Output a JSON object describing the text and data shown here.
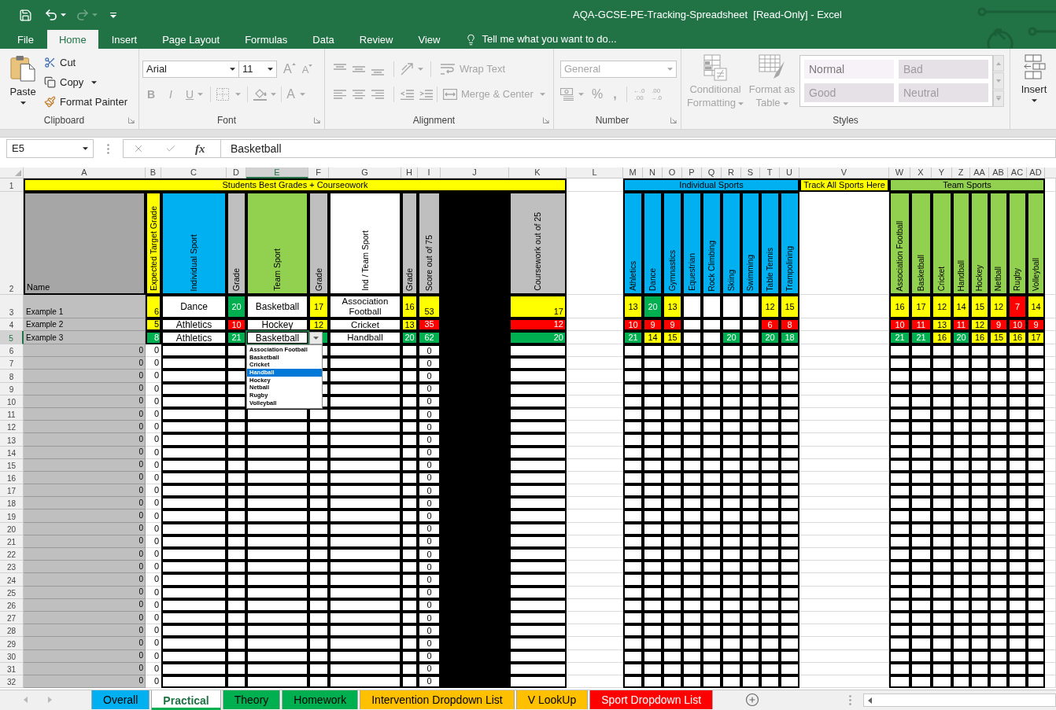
{
  "title_bar": {
    "title": "AQA-GCSE-PE-Tracking-Spreadsheet  [Read-Only] - Excel"
  },
  "ribbon_tabs": [
    {
      "label": "File",
      "selected": false
    },
    {
      "label": "Home",
      "selected": true
    },
    {
      "label": "Insert",
      "selected": false
    },
    {
      "label": "Page Layout",
      "selected": false
    },
    {
      "label": "Formulas",
      "selected": false
    },
    {
      "label": "Data",
      "selected": false
    },
    {
      "label": "Review",
      "selected": false
    },
    {
      "label": "View",
      "selected": false
    }
  ],
  "tell_me": {
    "placeholder": "Tell me what you want to do..."
  },
  "ribbon": {
    "clipboard": {
      "label": "Clipboard",
      "paste": {
        "label": "Paste",
        "disabled": false
      },
      "cut": {
        "label": "Cut",
        "disabled": false
      },
      "copy": {
        "label": "Copy",
        "disabled": false
      },
      "format_painter": {
        "label": "Format Painter",
        "disabled": false
      }
    },
    "font": {
      "label": "Font",
      "font_name": "Arial",
      "font_size": "11",
      "grow_font": {
        "label": "A",
        "disabled": true
      },
      "shrink_font": {
        "label": "A",
        "disabled": true
      },
      "bold": {
        "label": "B",
        "disabled": true
      },
      "italic": {
        "label": "I",
        "disabled": true
      },
      "underline": {
        "label": "U",
        "disabled": true
      },
      "borders": {
        "disabled": true
      },
      "fill_color": {
        "disabled": true
      },
      "font_color": {
        "label": "A",
        "disabled": true
      }
    },
    "alignment": {
      "label": "Alignment",
      "top_align": {
        "disabled": true
      },
      "middle_align": {
        "disabled": true
      },
      "bottom_align": {
        "disabled": true
      },
      "orientation": {
        "disabled": true
      },
      "wrap_text": {
        "label": "Wrap Text",
        "disabled": true
      },
      "align_left": {
        "disabled": true
      },
      "center": {
        "disabled": true
      },
      "align_right": {
        "disabled": true
      },
      "decrease_indent": {
        "disabled": true
      },
      "increase_indent": {
        "disabled": true
      },
      "merge_center": {
        "label": "Merge & Center",
        "disabled": true
      }
    },
    "number": {
      "label": "Number",
      "format": {
        "value": "General",
        "disabled": true
      },
      "currency": {
        "disabled": true
      },
      "percent": {
        "label": "%",
        "disabled": true
      },
      "comma": {
        "label": ",",
        "disabled": true
      },
      "increase_decimal": {
        "lines": [
          "←.0",
          ".00"
        ],
        "disabled": true
      },
      "decrease_decimal": {
        "lines": [
          ".00",
          "→.0"
        ],
        "disabled": true
      }
    },
    "styles": {
      "label": "Styles",
      "conditional_formatting": {
        "label": "Conditional Formatting",
        "disabled": true
      },
      "format_as_table": {
        "label": "Format as Table",
        "disabled": true
      },
      "gallery": [
        {
          "label": "Normal",
          "selected": true
        },
        {
          "label": "Bad",
          "selected": false
        },
        {
          "label": "Good",
          "selected": false
        },
        {
          "label": "Neutral",
          "selected": false
        }
      ]
    },
    "cells": {
      "insert": {
        "label": "Insert",
        "disabled": false
      }
    }
  },
  "formula_bar": {
    "name_box": "E5",
    "function_label": "fx",
    "formula": "Basketball"
  },
  "sheet": {
    "columns": [
      {
        "label": "A",
        "selected": false
      },
      {
        "label": "B",
        "selected": false
      },
      {
        "label": "C",
        "selected": false
      },
      {
        "label": "D",
        "selected": false
      },
      {
        "label": "E",
        "selected": true
      },
      {
        "label": "F",
        "selected": false
      },
      {
        "label": "G",
        "selected": false
      },
      {
        "label": "H",
        "selected": false
      },
      {
        "label": "I",
        "selected": false
      },
      {
        "label": "J",
        "selected": false
      },
      {
        "label": "K",
        "selected": false
      },
      {
        "label": "L",
        "selected": false
      },
      {
        "label": "M",
        "selected": false
      },
      {
        "label": "N",
        "selected": false
      },
      {
        "label": "O",
        "selected": false
      },
      {
        "label": "P",
        "selected": false
      },
      {
        "label": "Q",
        "selected": false
      },
      {
        "label": "R",
        "selected": false
      },
      {
        "label": "S",
        "selected": false
      },
      {
        "label": "T",
        "selected": false
      },
      {
        "label": "U",
        "selected": false
      },
      {
        "label": "V",
        "selected": false
      },
      {
        "label": "W",
        "selected": false
      },
      {
        "label": "X",
        "selected": false
      },
      {
        "label": "Y",
        "selected": false
      },
      {
        "label": "Z",
        "selected": false
      },
      {
        "label": "AA",
        "selected": false
      },
      {
        "label": "AB",
        "selected": false
      },
      {
        "label": "AC",
        "selected": false
      },
      {
        "label": "AD",
        "selected": false
      }
    ],
    "row_numbers": [
      {
        "label": "1",
        "selected": false
      },
      {
        "label": "2",
        "selected": false
      },
      {
        "label": "3",
        "selected": false
      },
      {
        "label": "4",
        "selected": false
      },
      {
        "label": "5",
        "selected": true
      },
      {
        "label": "6",
        "selected": false
      },
      {
        "label": "7",
        "selected": false
      },
      {
        "label": "8",
        "selected": false
      },
      {
        "label": "9",
        "selected": false
      },
      {
        "label": "10",
        "selected": false
      },
      {
        "label": "11",
        "selected": false
      },
      {
        "label": "12",
        "selected": false
      },
      {
        "label": "13",
        "selected": false
      },
      {
        "label": "14",
        "selected": false
      },
      {
        "label": "15",
        "selected": false
      },
      {
        "label": "16",
        "selected": false
      },
      {
        "label": "17",
        "selected": false
      },
      {
        "label": "18",
        "selected": false
      },
      {
        "label": "19",
        "selected": false
      },
      {
        "label": "20",
        "selected": false
      },
      {
        "label": "21",
        "selected": false
      },
      {
        "label": "22",
        "selected": false
      },
      {
        "label": "23",
        "selected": false
      },
      {
        "label": "24",
        "selected": false
      },
      {
        "label": "25",
        "selected": false
      },
      {
        "label": "26",
        "selected": false
      },
      {
        "label": "27",
        "selected": false
      },
      {
        "label": "28",
        "selected": false
      },
      {
        "label": "29",
        "selected": false
      },
      {
        "label": "30",
        "selected": false
      },
      {
        "label": "31",
        "selected": false
      },
      {
        "label": "32",
        "selected": false
      }
    ],
    "banners": [
      {
        "text": "Students Best Grades + Courseowork",
        "color": "#ffff00"
      },
      {
        "text": "Individual Sports",
        "color": "#00b0f0"
      },
      {
        "text": "Track All Sports Here",
        "color": "#ffff00"
      },
      {
        "text": "Team Sports",
        "color": "#92d050"
      }
    ],
    "headings": [
      {
        "kind": "label",
        "text": "Name",
        "color": "#a6a6a6"
      },
      {
        "kind": "rotated",
        "text": "Expected Target Grade",
        "color": "#ffff00"
      },
      {
        "kind": "rotated",
        "text": "Individual Sport",
        "color": "#00b0f0"
      },
      {
        "kind": "rotated",
        "text": "Grade",
        "color": "#bfbfbf"
      },
      {
        "kind": "rotated",
        "text": "Team Sport",
        "color": "#92d050"
      },
      {
        "kind": "rotated",
        "text": "Grade",
        "color": "#bfbfbf"
      },
      {
        "kind": "rotated",
        "text": "Ind / Team Sport",
        "color": "#ffffff"
      },
      {
        "kind": "rotated",
        "text": "Grade",
        "color": "#bfbfbf"
      },
      {
        "kind": "rotated",
        "text": "Score out of 75",
        "color": "#bfbfbf"
      },
      {
        "kind": "fill",
        "color": "#000000"
      },
      {
        "kind": "rotated",
        "text": "Coursework out of 25",
        "color": "#bfbfbf"
      }
    ],
    "individual_sports": [
      "Athletics",
      "Dance",
      "Gymnastics",
      "Equestrian",
      "Rock Climbing",
      "Skiing",
      "Swimming",
      "Table Tennis",
      "Trampolining"
    ],
    "team_sports": [
      "Association Football",
      "Basketball",
      "Cricket",
      "Handball",
      "Hockey",
      "Netball",
      "Rugby",
      "Volleyball"
    ],
    "students": [
      {
        "name": "Example 1",
        "target": {
          "text": "6",
          "color": "#ffff00"
        },
        "individual_sport": "Dance",
        "individual_grade": {
          "text": "20",
          "color": "#00b050"
        },
        "team_sport": "Basketball",
        "team_grade": {
          "text": "17",
          "color": "#ffff00"
        },
        "ind_team_sport": "Association Football",
        "ind_team_grade": {
          "text": "16",
          "color": "#ffff00"
        },
        "score": {
          "text": "53",
          "color": "#ffff00"
        },
        "coursework": {
          "text": "17",
          "color": "#ffff00"
        },
        "individual_sport_grades": [
          {
            "kind": "grade",
            "text": "13",
            "color": "#ffff00"
          },
          {
            "kind": "grade",
            "text": "20",
            "color": "#00b050"
          },
          {
            "kind": "grade",
            "text": "13",
            "color": "#ffff00"
          },
          {
            "kind": "empty"
          },
          {
            "kind": "empty"
          },
          {
            "kind": "empty"
          },
          {
            "kind": "empty"
          },
          {
            "kind": "grade",
            "text": "12",
            "color": "#ffff00"
          },
          {
            "kind": "grade",
            "text": "15",
            "color": "#ffff00"
          }
        ],
        "team_sport_grades": [
          {
            "kind": "grade",
            "text": "16",
            "color": "#ffff00"
          },
          {
            "kind": "grade",
            "text": "17",
            "color": "#ffff00"
          },
          {
            "kind": "grade",
            "text": "12",
            "color": "#ffff00"
          },
          {
            "kind": "grade",
            "text": "14",
            "color": "#ffff00"
          },
          {
            "kind": "grade",
            "text": "15",
            "color": "#ffff00"
          },
          {
            "kind": "grade",
            "text": "12",
            "color": "#ffff00"
          },
          {
            "kind": "grade",
            "text": "7",
            "color": "#ff0000"
          },
          {
            "kind": "grade",
            "text": "14",
            "color": "#ffff00"
          }
        ]
      },
      {
        "name": "Example 2",
        "target": {
          "text": "5",
          "color": "#ffff00"
        },
        "individual_sport": "Athletics",
        "individual_grade": {
          "text": "10",
          "color": "#ff0000"
        },
        "team_sport": "Hockey",
        "team_grade": {
          "text": "12",
          "color": "#ffff00"
        },
        "ind_team_sport": "Cricket",
        "ind_team_grade": {
          "text": "13",
          "color": "#ffff00"
        },
        "score": {
          "text": "35",
          "color": "#ff0000"
        },
        "coursework": {
          "text": "12",
          "color": "#ff0000"
        },
        "individual_sport_grades": [
          {
            "kind": "grade",
            "text": "10",
            "color": "#ff0000"
          },
          {
            "kind": "grade",
            "text": "9",
            "color": "#ff0000"
          },
          {
            "kind": "grade",
            "text": "9",
            "color": "#ff0000"
          },
          {
            "kind": "empty"
          },
          {
            "kind": "empty"
          },
          {
            "kind": "empty"
          },
          {
            "kind": "empty"
          },
          {
            "kind": "grade",
            "text": "6",
            "color": "#ff0000"
          },
          {
            "kind": "grade",
            "text": "8",
            "color": "#ff0000"
          }
        ],
        "team_sport_grades": [
          {
            "kind": "grade",
            "text": "10",
            "color": "#ff0000"
          },
          {
            "kind": "grade",
            "text": "11",
            "color": "#ff0000"
          },
          {
            "kind": "grade",
            "text": "13",
            "color": "#ffff00"
          },
          {
            "kind": "grade",
            "text": "11",
            "color": "#ff0000"
          },
          {
            "kind": "grade",
            "text": "12",
            "color": "#ffff00"
          },
          {
            "kind": "grade",
            "text": "9",
            "color": "#ff0000"
          },
          {
            "kind": "grade",
            "text": "10",
            "color": "#ff0000"
          },
          {
            "kind": "grade",
            "text": "9",
            "color": "#ff0000"
          }
        ]
      },
      {
        "name": "Example 3",
        "target": {
          "text": "8",
          "color": "#00b050"
        },
        "individual_sport": "Athletics",
        "individual_grade": {
          "text": "21",
          "color": "#00b050"
        },
        "team_sport": "Basketball",
        "team_grade": {
          "color": "#00b050"
        },
        "ind_team_sport": "Handball",
        "ind_team_grade": {
          "text": "20",
          "color": "#00b050"
        },
        "score": {
          "text": "62",
          "color": "#00b050"
        },
        "coursework": {
          "text": "20",
          "color": "#00b050"
        },
        "individual_sport_grades": [
          {
            "kind": "grade",
            "text": "21",
            "color": "#00b050"
          },
          {
            "kind": "grade",
            "text": "14",
            "color": "#ffff00"
          },
          {
            "kind": "grade",
            "text": "15",
            "color": "#ffff00"
          },
          {
            "kind": "empty"
          },
          {
            "kind": "empty"
          },
          {
            "kind": "grade",
            "text": "20",
            "color": "#00b050"
          },
          {
            "kind": "empty"
          },
          {
            "kind": "grade",
            "text": "20",
            "color": "#00b050"
          },
          {
            "kind": "grade",
            "text": "18",
            "color": "#00b050"
          }
        ],
        "team_sport_grades": [
          {
            "kind": "grade",
            "text": "21",
            "color": "#00b050"
          },
          {
            "kind": "grade",
            "text": "21",
            "color": "#00b050"
          },
          {
            "kind": "grade",
            "text": "16",
            "color": "#ffff00"
          },
          {
            "kind": "grade",
            "text": "20",
            "color": "#00b050"
          },
          {
            "kind": "grade",
            "text": "16",
            "color": "#ffff00"
          },
          {
            "kind": "grade",
            "text": "15",
            "color": "#ffff00"
          },
          {
            "kind": "grade",
            "text": "16",
            "color": "#ffff00"
          },
          {
            "kind": "grade",
            "text": "17",
            "color": "#ffff00"
          }
        ]
      }
    ],
    "blank_rows": [
      {
        "name": "0",
        "target": "0",
        "score": "0"
      },
      {
        "name": "0",
        "target": "0",
        "score": "0"
      },
      {
        "name": "0",
        "target": "0",
        "score": "0"
      },
      {
        "name": "0",
        "target": "0",
        "score": "0"
      },
      {
        "name": "0",
        "target": "0",
        "score": "0"
      },
      {
        "name": "0",
        "target": "0",
        "score": "0"
      },
      {
        "name": "0",
        "target": "0",
        "score": "0"
      },
      {
        "name": "0",
        "target": "0",
        "score": "0"
      },
      {
        "name": "0",
        "target": "0",
        "score": "0"
      },
      {
        "name": "0",
        "target": "0",
        "score": "0"
      },
      {
        "name": "0",
        "target": "0",
        "score": "0"
      },
      {
        "name": "0",
        "target": "0",
        "score": "0"
      },
      {
        "name": "0",
        "target": "0",
        "score": "0"
      },
      {
        "name": "0",
        "target": "0",
        "score": "0"
      },
      {
        "name": "0",
        "target": "0",
        "score": "0"
      },
      {
        "name": "0",
        "target": "0",
        "score": "0"
      },
      {
        "name": "0",
        "target": "0",
        "score": "0"
      },
      {
        "name": "0",
        "target": "0",
        "score": "0"
      },
      {
        "name": "0",
        "target": "0",
        "score": "0"
      },
      {
        "name": "0",
        "target": "0",
        "score": "0"
      },
      {
        "name": "0",
        "target": "0",
        "score": "0"
      },
      {
        "name": "0",
        "target": "0",
        "score": "0"
      },
      {
        "name": "0",
        "target": "0",
        "score": "0"
      },
      {
        "name": "0",
        "target": "0",
        "score": "0"
      },
      {
        "name": "0",
        "target": "0",
        "score": "0"
      },
      {
        "name": "0",
        "target": "0",
        "score": "0"
      },
      {
        "name": "0",
        "target": "0",
        "score": "0"
      }
    ],
    "dropdown": {
      "items": [
        {
          "label": "Association Football",
          "selected": false
        },
        {
          "label": "Basketball",
          "selected": false
        },
        {
          "label": "Cricket",
          "selected": false
        },
        {
          "label": "Handball",
          "selected": true
        },
        {
          "label": "Hockey",
          "selected": false
        },
        {
          "label": "Netball",
          "selected": false
        },
        {
          "label": "Rugby",
          "selected": false
        },
        {
          "label": "Volleyball",
          "selected": false
        }
      ]
    }
  },
  "sheet_tabs": [
    {
      "label": "Overall",
      "selected": false,
      "color": "#00b0f0"
    },
    {
      "label": "Practical",
      "selected": true,
      "color": "#00b050"
    },
    {
      "label": "Theory",
      "selected": false,
      "color": "#00b050"
    },
    {
      "label": "Homework",
      "selected": false,
      "color": "#00b050"
    },
    {
      "label": "Intervention Dropdown List",
      "selected": false,
      "color": "#ffc000"
    },
    {
      "label": "V LookUp",
      "selected": false,
      "color": "#ffc000"
    },
    {
      "label": "Sport Dropdown List",
      "selected": false,
      "color": "#ff0000"
    }
  ]
}
